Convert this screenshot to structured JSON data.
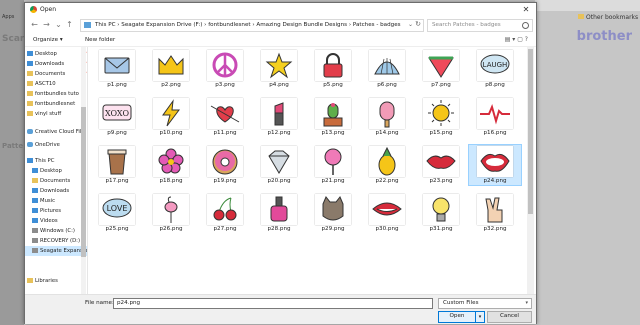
{
  "background": {
    "app_text": "Apps",
    "page_title": "Scan",
    "pattern_text": "Patte",
    "brand": "brother",
    "bookmarks": "Other bookmarks"
  },
  "dialog": {
    "title": "Open",
    "close_label": "✕",
    "nav": {
      "back": "←",
      "forward": "→",
      "recent": "⌄",
      "up": "↑"
    },
    "address": {
      "path": "This PC  ›  Seagate Expansion Drive (F:)  ›  fontbundlesnet  ›  Amazing Design Bundle Designs  ›  Patches - badges",
      "chevron": "⌄",
      "refresh": "↻"
    },
    "search": {
      "placeholder": "Search Patches - badges"
    },
    "command_bar": {
      "organize": "Organize ▾",
      "new_folder": "New folder",
      "icons": "▤ ▾  ▢  ?"
    },
    "sidebar": [
      {
        "label": "Desktop",
        "icon": "desktop-icon",
        "pinned": true
      },
      {
        "label": "Downloads",
        "icon": "downloads-icon",
        "pinned": true
      },
      {
        "label": "Documents",
        "icon": "documents-icon",
        "pinned": true
      },
      {
        "label": "ASCT10",
        "icon": "folder-icon",
        "pinned": false
      },
      {
        "label": "fontbundles tuto",
        "icon": "folder-icon",
        "pinned": false
      },
      {
        "label": "fontbundlesnet",
        "icon": "folder-icon",
        "pinned": false
      },
      {
        "label": "vinyl stuff",
        "icon": "folder-icon",
        "pinned": false
      },
      {
        "label": "Creative Cloud Fil",
        "icon": "creative-cloud-icon",
        "pinned": false
      },
      {
        "label": "OneDrive",
        "icon": "onedrive-icon",
        "pinned": false
      },
      {
        "label": "This PC",
        "icon": "this-pc-icon",
        "pinned": false
      },
      {
        "label": "Desktop",
        "icon": "desktop-icon",
        "pinned": false
      },
      {
        "label": "Documents",
        "icon": "documents-icon",
        "pinned": false
      },
      {
        "label": "Downloads",
        "icon": "downloads-icon",
        "pinned": false
      },
      {
        "label": "Music",
        "icon": "music-icon",
        "pinned": false
      },
      {
        "label": "Pictures",
        "icon": "pictures-icon",
        "pinned": false
      },
      {
        "label": "Videos",
        "icon": "videos-icon",
        "pinned": false
      },
      {
        "label": "Windows (C:)",
        "icon": "drive-icon",
        "pinned": false
      },
      {
        "label": "RECOVERY (D:)",
        "icon": "drive-icon",
        "pinned": false
      },
      {
        "label": "Seagate Expansion",
        "icon": "drive-icon",
        "pinned": false
      },
      {
        "label": "Libraries",
        "icon": "libraries-icon",
        "pinned": false
      }
    ],
    "files": [
      {
        "name": "p1.png",
        "icon": "envelope"
      },
      {
        "name": "p2.png",
        "icon": "crown"
      },
      {
        "name": "p3.png",
        "icon": "peace-sign"
      },
      {
        "name": "p4.png",
        "icon": "star"
      },
      {
        "name": "p5.png",
        "icon": "padlock"
      },
      {
        "name": "p6.png",
        "icon": "seashell"
      },
      {
        "name": "p7.png",
        "icon": "watermelon"
      },
      {
        "name": "p8.png",
        "icon": "laugh-bubble"
      },
      {
        "name": "p9.png",
        "icon": "xoxo-bubble"
      },
      {
        "name": "p10.png",
        "icon": "lightning-bolt"
      },
      {
        "name": "p11.png",
        "icon": "heart-arrow"
      },
      {
        "name": "p12.png",
        "icon": "lipstick"
      },
      {
        "name": "p13.png",
        "icon": "cactus"
      },
      {
        "name": "p14.png",
        "icon": "popsicle"
      },
      {
        "name": "p15.png",
        "icon": "sun"
      },
      {
        "name": "p16.png",
        "icon": "heartbeat"
      },
      {
        "name": "p17.png",
        "icon": "coffee-cup"
      },
      {
        "name": "p18.png",
        "icon": "flower"
      },
      {
        "name": "p19.png",
        "icon": "donut"
      },
      {
        "name": "p20.png",
        "icon": "diamond"
      },
      {
        "name": "p21.png",
        "icon": "lollipop"
      },
      {
        "name": "p22.png",
        "icon": "pineapple"
      },
      {
        "name": "p23.png",
        "icon": "lips"
      },
      {
        "name": "p24.png",
        "icon": "open-mouth",
        "selected": true
      },
      {
        "name": "p25.png",
        "icon": "love-bubble"
      },
      {
        "name": "p26.png",
        "icon": "flamingo"
      },
      {
        "name": "p27.png",
        "icon": "cherries"
      },
      {
        "name": "p28.png",
        "icon": "nail-polish"
      },
      {
        "name": "p29.png",
        "icon": "cat"
      },
      {
        "name": "p30.png",
        "icon": "smiling-lips"
      },
      {
        "name": "p31.png",
        "icon": "light-bulb"
      },
      {
        "name": "p32.png",
        "icon": "peace-hand"
      }
    ],
    "file_name_label": "File name:",
    "file_name_value": "p24.png",
    "file_type": "Custom Files",
    "open_label": "Open",
    "open_split": "▾",
    "cancel_label": "Cancel"
  }
}
